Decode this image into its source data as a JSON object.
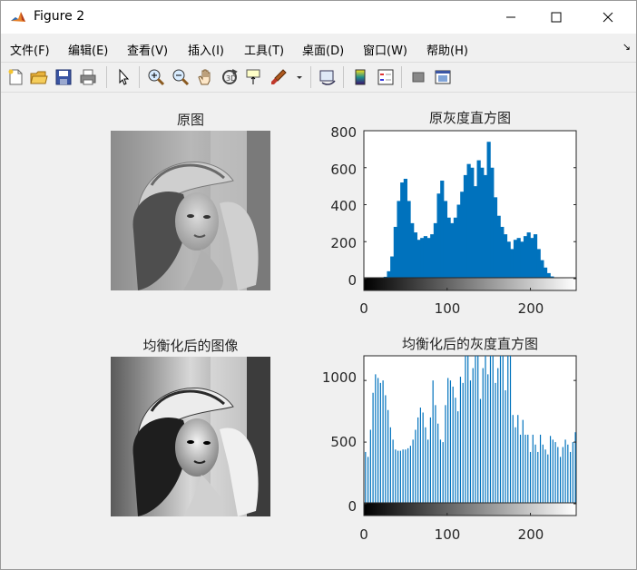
{
  "window": {
    "title": "Figure 2"
  },
  "menu": {
    "items": [
      "文件(F)",
      "编辑(E)",
      "查看(V)",
      "插入(I)",
      "工具(T)",
      "桌面(D)",
      "窗口(W)",
      "帮助(H)"
    ]
  },
  "toolbar": {
    "icons": [
      "new-figure-icon",
      "open-file-icon",
      "save-icon",
      "print-icon",
      "pointer-icon",
      "zoom-in-icon",
      "zoom-out-icon",
      "pan-icon",
      "rotate-3d-icon",
      "data-cursor-icon",
      "brush-icon",
      "link-plot-icon",
      "colorbar-icon",
      "legend-icon",
      "hide-plot-tools-icon",
      "show-plot-tools-icon"
    ]
  },
  "panels": {
    "original_title": "原图",
    "orig_hist_title": "原灰度直方图",
    "equalized_title": "均衡化后的图像",
    "eq_hist_title": "均衡化后的灰度直方图"
  },
  "chart_data": [
    {
      "type": "bar",
      "title": "原灰度直方图",
      "xlabel": "",
      "ylabel": "",
      "xlim": [
        0,
        255
      ],
      "ylim": [
        0,
        800
      ],
      "x_ticks": [
        "0",
        "100",
        "200"
      ],
      "y_ticks": [
        "0",
        "200",
        "400",
        "600",
        "800"
      ],
      "bar_color": "#0072BD",
      "x": [
        26,
        30,
        34,
        38,
        42,
        46,
        50,
        54,
        58,
        62,
        66,
        70,
        74,
        78,
        82,
        86,
        90,
        94,
        98,
        102,
        106,
        110,
        114,
        118,
        122,
        126,
        130,
        134,
        138,
        142,
        146,
        150,
        154,
        158,
        162,
        166,
        170,
        174,
        178,
        182,
        186,
        190,
        194,
        198,
        202,
        206,
        210,
        214,
        218,
        222,
        226,
        230
      ],
      "values": [
        10,
        40,
        120,
        280,
        420,
        520,
        540,
        420,
        300,
        250,
        210,
        220,
        230,
        220,
        240,
        300,
        460,
        530,
        420,
        330,
        300,
        330,
        400,
        470,
        560,
        620,
        600,
        500,
        640,
        600,
        560,
        740,
        600,
        440,
        340,
        280,
        240,
        200,
        160,
        210,
        220,
        200,
        230,
        250,
        220,
        240,
        160,
        100,
        60,
        30,
        12,
        4
      ]
    },
    {
      "type": "bar",
      "title": "均衡化后的灰度直方图",
      "xlabel": "",
      "ylabel": "",
      "xlim": [
        0,
        255
      ],
      "ylim": [
        0,
        1200
      ],
      "x_ticks": [
        "0",
        "100",
        "200"
      ],
      "y_ticks": [
        "0",
        "500",
        "1000"
      ],
      "bar_color": "#0072BD",
      "x": [
        2,
        5,
        8,
        11,
        14,
        17,
        20,
        23,
        26,
        29,
        32,
        35,
        38,
        41,
        44,
        47,
        50,
        53,
        56,
        59,
        62,
        65,
        68,
        71,
        74,
        77,
        80,
        83,
        86,
        89,
        92,
        95,
        98,
        101,
        104,
        107,
        110,
        113,
        116,
        119,
        122,
        125,
        128,
        131,
        134,
        137,
        140,
        143,
        146,
        149,
        152,
        155,
        158,
        161,
        164,
        167,
        170,
        173,
        176,
        179,
        182,
        185,
        188,
        191,
        194,
        197,
        200,
        203,
        206,
        209,
        212,
        215,
        218,
        221,
        224,
        227,
        230,
        233,
        236,
        239,
        242,
        245,
        248,
        251,
        254
      ],
      "values": [
        420,
        380,
        600,
        900,
        1050,
        1020,
        980,
        1000,
        880,
        760,
        620,
        520,
        440,
        430,
        430,
        440,
        440,
        450,
        470,
        520,
        600,
        700,
        780,
        740,
        620,
        520,
        700,
        1000,
        800,
        650,
        520,
        500,
        800,
        1020,
        1000,
        950,
        860,
        750,
        1030,
        980,
        1200,
        1200,
        1000,
        1100,
        1200,
        1200,
        850,
        1100,
        1200,
        1050,
        1200,
        1200,
        980,
        1100,
        1200,
        1200,
        920,
        1200,
        1200,
        720,
        620,
        720,
        560,
        680,
        560,
        560,
        420,
        560,
        480,
        420,
        560,
        480,
        440,
        400,
        550,
        520,
        500,
        460,
        380,
        460,
        520,
        480,
        420,
        500,
        580
      ]
    }
  ]
}
